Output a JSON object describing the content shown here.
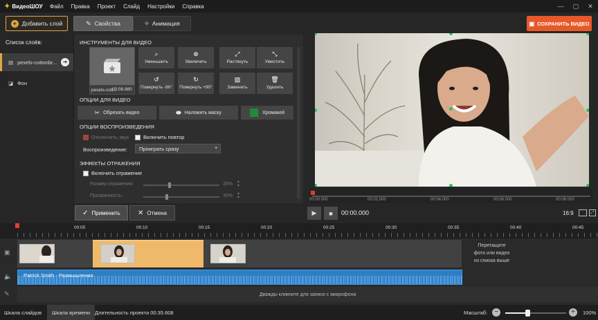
{
  "app": {
    "title": "ВидеоШОУ"
  },
  "menu": [
    "Файл",
    "Правка",
    "Проект",
    "Слайд",
    "Настройки",
    "Справка"
  ],
  "toolbar": {
    "add_layer": "Добавить слой",
    "tab_properties": "Свойства",
    "tab_animation": "Анимация",
    "save_video": "СОХРАНИТЬ ВИДЕО"
  },
  "layers": {
    "title": "Список слоёв:",
    "items": [
      {
        "label": "pexels-cottonbr..."
      },
      {
        "label": "Фон"
      }
    ]
  },
  "properties": {
    "tools_title": "ИНСТРУМЕНТЫ ДЛЯ ВИДЕО",
    "clip_name": "pexels-cott...",
    "clip_duration": "00:08.880",
    "tools": [
      {
        "label": "Уменьшить",
        "icon": "zoom-out-icon"
      },
      {
        "label": "Увеличить",
        "icon": "zoom-in-icon"
      },
      {
        "label": "Растянуть",
        "icon": "stretch-icon"
      },
      {
        "label": "Уместить",
        "icon": "fit-icon"
      },
      {
        "label": "Повернуть -90°",
        "icon": "rotate-left-icon"
      },
      {
        "label": "Повернуть +90°",
        "icon": "rotate-right-icon"
      },
      {
        "label": "Заменить",
        "icon": "image-replace-icon"
      },
      {
        "label": "Удалить",
        "icon": "trash-icon"
      }
    ],
    "video_options_title": "ОПЦИИ ДЛЯ ВИДЕО",
    "trim": "Обрезать видео",
    "mask": "Наложить маску",
    "chroma": "Хромакей",
    "playback_title": "ОПЦИИ ВОСПРОИЗВЕДЕНИЯ",
    "mute": "Отключить звук",
    "loop": "Включить повтор",
    "playback_label": "Воспроизведение:",
    "playback_value": "Проиграть сразу",
    "reflection_title": "ЭФФЕКТЫ ОТРАЖЕНИЯ",
    "reflection_enable": "Включить отражение",
    "reflection_size_label": "Размер отражения:",
    "reflection_size_value": "35%",
    "transparency_label": "Прозрачность:",
    "transparency_value": "30%",
    "chroma_color": "#1e8a3c"
  },
  "actions": {
    "apply": "Применить",
    "cancel": "Отмена"
  },
  "preview": {
    "ruler_labels": [
      "00:00.000",
      "00:02.000",
      "00:04.000",
      "00:06.000",
      "00:08.000"
    ],
    "timecode": "00:00.000",
    "aspect": "16:9"
  },
  "timeline": {
    "ruler_labels": [
      "00:05",
      "00:10",
      "00:15",
      "00:20",
      "00:25",
      "00:30",
      "00:35",
      "00:40",
      "00:45"
    ],
    "drop_hint_1": "Перетащите",
    "drop_hint_2": "фото или видео",
    "drop_hint_3": "из списка выше",
    "audio_title": "Patrick Smith - Размышления",
    "mic_hint": "Дважды кликните для записи с микрофона"
  },
  "status": {
    "tab_slides": "Шкала слайдов",
    "tab_timeline": "Шкала времени",
    "duration": "Длительность проекта 00:35.608",
    "zoom_label": "Масштаб:",
    "zoom_value": "100%",
    "zoom_level": 0.36
  }
}
